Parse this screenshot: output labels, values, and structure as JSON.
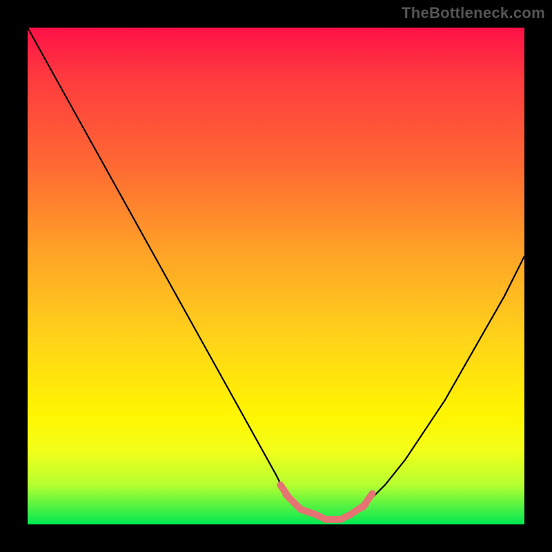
{
  "watermark": "TheBottleneck.com",
  "colors": {
    "frame": "#000000",
    "curve": "#000000",
    "highlight": "#e57373",
    "gradient_stops": [
      "#ff1047",
      "#ff3a3f",
      "#ff6a33",
      "#ffa227",
      "#ffd21a",
      "#fff500",
      "#f4ff1a",
      "#b6ff30",
      "#00e852"
    ]
  },
  "chart_data": {
    "type": "line",
    "title": "",
    "xlabel": "",
    "ylabel": "",
    "xlim": [
      0,
      100
    ],
    "ylim": [
      0,
      100
    ],
    "x": [
      0,
      5,
      10,
      15,
      20,
      25,
      30,
      35,
      40,
      45,
      50,
      52,
      55,
      58,
      60,
      63,
      65,
      68,
      72,
      76,
      80,
      84,
      88,
      92,
      96,
      100
    ],
    "values": [
      100,
      91,
      82,
      73,
      64,
      55,
      46,
      37,
      28,
      19,
      10,
      6,
      3,
      2,
      1,
      1,
      2,
      4,
      8,
      13,
      19,
      25,
      32,
      39,
      46,
      54
    ],
    "highlight_range": {
      "x_start": 52,
      "x_end": 68
    },
    "notes": "V-shaped curve with a flat minimum around x≈55–65; axes are unlabeled in the source image so values are proportional (0–100). Highlighted pink segment spans the low region near the bottom."
  }
}
